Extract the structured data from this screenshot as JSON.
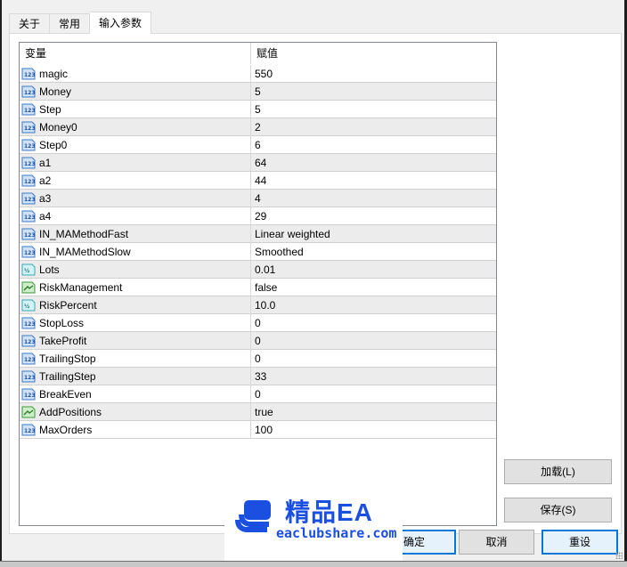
{
  "tabs": [
    {
      "label": "关于",
      "active": false
    },
    {
      "label": "常用",
      "active": false
    },
    {
      "label": "输入参数",
      "active": true
    }
  ],
  "grid": {
    "columns": [
      "变量",
      "赋值"
    ],
    "rows": [
      {
        "type": "int",
        "name": "magic",
        "value": "550"
      },
      {
        "type": "int",
        "name": "Money",
        "value": "5"
      },
      {
        "type": "int",
        "name": "Step",
        "value": "5"
      },
      {
        "type": "int",
        "name": "Money0",
        "value": "2"
      },
      {
        "type": "int",
        "name": "Step0",
        "value": "6"
      },
      {
        "type": "int",
        "name": "a1",
        "value": "64"
      },
      {
        "type": "int",
        "name": "a2",
        "value": "44"
      },
      {
        "type": "int",
        "name": "a3",
        "value": "4"
      },
      {
        "type": "int",
        "name": "a4",
        "value": "29"
      },
      {
        "type": "int",
        "name": "IN_MAMethodFast",
        "value": "Linear weighted"
      },
      {
        "type": "int",
        "name": "IN_MAMethodSlow",
        "value": "Smoothed"
      },
      {
        "type": "double",
        "name": "Lots",
        "value": "0.01"
      },
      {
        "type": "bool",
        "name": "RiskManagement",
        "value": "false"
      },
      {
        "type": "double",
        "name": "RiskPercent",
        "value": "10.0"
      },
      {
        "type": "int",
        "name": "StopLoss",
        "value": "0"
      },
      {
        "type": "int",
        "name": "TakeProfit",
        "value": "0"
      },
      {
        "type": "int",
        "name": "TrailingStop",
        "value": "0"
      },
      {
        "type": "int",
        "name": "TrailingStep",
        "value": "33"
      },
      {
        "type": "int",
        "name": "BreakEven",
        "value": "0"
      },
      {
        "type": "bool",
        "name": "AddPositions",
        "value": "true"
      },
      {
        "type": "int",
        "name": "MaxOrders",
        "value": "100"
      }
    ]
  },
  "side_buttons": {
    "load": "加载(L)",
    "save": "保存(S)"
  },
  "footer_buttons": {
    "ok": "确定",
    "cancel": "取消",
    "reset": "重设"
  },
  "watermark": {
    "title": "精品EA",
    "url": "eaclubshare.com",
    "color": "#1a4fe0"
  }
}
